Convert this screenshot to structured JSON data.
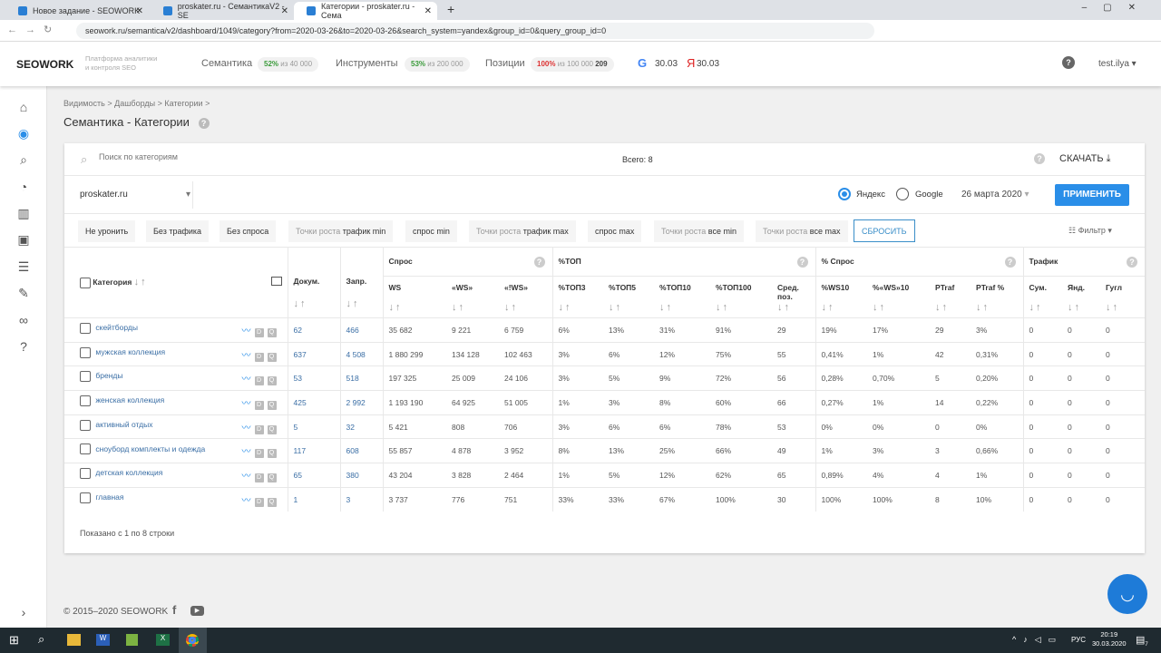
{
  "browser": {
    "tabs": [
      {
        "title": "Новое задание - SEOWORK"
      },
      {
        "title": "proskater.ru - СемантикаV2 - SE"
      },
      {
        "title": "Категории - proskater.ru - Сема"
      }
    ],
    "url": "seowork.ru/semantica/v2/dashboard/1049/category?from=2020-03-26&to=2020-03-26&search_system=yandex&group_id=0&query_group_id=0"
  },
  "header": {
    "logo": "SEOWORK",
    "tagline1": "Платформа аналитики",
    "tagline2": "и контроля SEO",
    "limits": [
      {
        "label": "Семантика",
        "pct": "52%",
        "of": "из 40 000",
        "color": "#3a9a3a"
      },
      {
        "label": "Инструменты",
        "pct": "53%",
        "of": "из 200 000",
        "color": "#3a9a3a"
      },
      {
        "label": "Позиции",
        "pct": "100%",
        "of": "из 100 000",
        "extra": "209",
        "color": "#d33"
      }
    ],
    "google_date": "30.03",
    "yandex_date": "30.03",
    "user": "test.ilya"
  },
  "breadcrumb": [
    "Видимость",
    "Дашборды",
    "Категории"
  ],
  "page_title": "Семантика",
  "page_subtitle": "Категории",
  "toolbar": {
    "search_placeholder": "Поиск по категориям",
    "total": "Всего: 8",
    "download": "СКАЧАТЬ",
    "project": "proskater.ru",
    "engine_yandex": "Яндекс",
    "engine_google": "Google",
    "date": "26 марта 2020",
    "apply": "ПРИМЕНИТЬ",
    "reset": "СБРОСИТЬ",
    "filter": "Фильтр"
  },
  "chips": [
    {
      "a": "",
      "b": "Не уронить"
    },
    {
      "a": "",
      "b": "Без трафика"
    },
    {
      "a": "",
      "b": "Без спроса"
    },
    {
      "a": "Точки роста ",
      "b": "трафик min"
    },
    {
      "a": "",
      "b": "спрос min"
    },
    {
      "a": "Точки роста ",
      "b": "трафик max"
    },
    {
      "a": "",
      "b": "спрос max"
    },
    {
      "a": "Точки роста ",
      "b": "все min"
    },
    {
      "a": "Точки роста ",
      "b": "все max"
    }
  ],
  "table": {
    "groups": {
      "demand": "Спрос",
      "top": "%ТОП",
      "pdemand": "% Спрос",
      "traffic": "Трафик"
    },
    "columns": [
      "Категория",
      "Докум.",
      "Запр.",
      "WS",
      "«WS»",
      "«!WS»",
      "%ТОП3",
      "%ТОП5",
      "%ТОП10",
      "%ТОП100",
      "Сред. поз.",
      "%WS10",
      "%«WS»10",
      "PTraf",
      "PTraf %",
      "Сум.",
      "Янд.",
      "Гугл"
    ],
    "rows": [
      [
        "скейтборды",
        "62",
        "466",
        "35 682",
        "9 221",
        "6 759",
        "6%",
        "13%",
        "31%",
        "91%",
        "29",
        "19%",
        "17%",
        "29",
        "3%",
        "0",
        "0",
        "0"
      ],
      [
        "мужская коллекция",
        "637",
        "4 508",
        "1 880 299",
        "134 128",
        "102 463",
        "3%",
        "6%",
        "12%",
        "75%",
        "55",
        "0,41%",
        "1%",
        "42",
        "0,31%",
        "0",
        "0",
        "0"
      ],
      [
        "бренды",
        "53",
        "518",
        "197 325",
        "25 009",
        "24 106",
        "3%",
        "5%",
        "9%",
        "72%",
        "56",
        "0,28%",
        "0,70%",
        "5",
        "0,20%",
        "0",
        "0",
        "0"
      ],
      [
        "женская коллекция",
        "425",
        "2 992",
        "1 193 190",
        "64 925",
        "51 005",
        "1%",
        "3%",
        "8%",
        "60%",
        "66",
        "0,27%",
        "1%",
        "14",
        "0,22%",
        "0",
        "0",
        "0"
      ],
      [
        "активный отдых",
        "5",
        "32",
        "5 421",
        "808",
        "706",
        "3%",
        "6%",
        "6%",
        "78%",
        "53",
        "0%",
        "0%",
        "0",
        "0%",
        "0",
        "0",
        "0"
      ],
      [
        "сноуборд комплекты и одежда",
        "117",
        "608",
        "55 857",
        "4 878",
        "3 952",
        "8%",
        "13%",
        "25%",
        "66%",
        "49",
        "1%",
        "3%",
        "3",
        "0,66%",
        "0",
        "0",
        "0"
      ],
      [
        "детская коллекция",
        "65",
        "380",
        "43 204",
        "3 828",
        "2 464",
        "1%",
        "5%",
        "12%",
        "62%",
        "65",
        "0,89%",
        "4%",
        "4",
        "1%",
        "0",
        "0",
        "0"
      ],
      [
        "главная",
        "1",
        "3",
        "3 737",
        "776",
        "751",
        "33%",
        "33%",
        "67%",
        "100%",
        "30",
        "100%",
        "100%",
        "8",
        "10%",
        "0",
        "0",
        "0"
      ]
    ]
  },
  "pagination": "Показано с 1 по 8 строки",
  "footer": "© 2015–2020 SEOWORK",
  "taskbar": {
    "lang": "РУС",
    "time": "20:19",
    "date": "30.03.2020",
    "notif": "7"
  }
}
